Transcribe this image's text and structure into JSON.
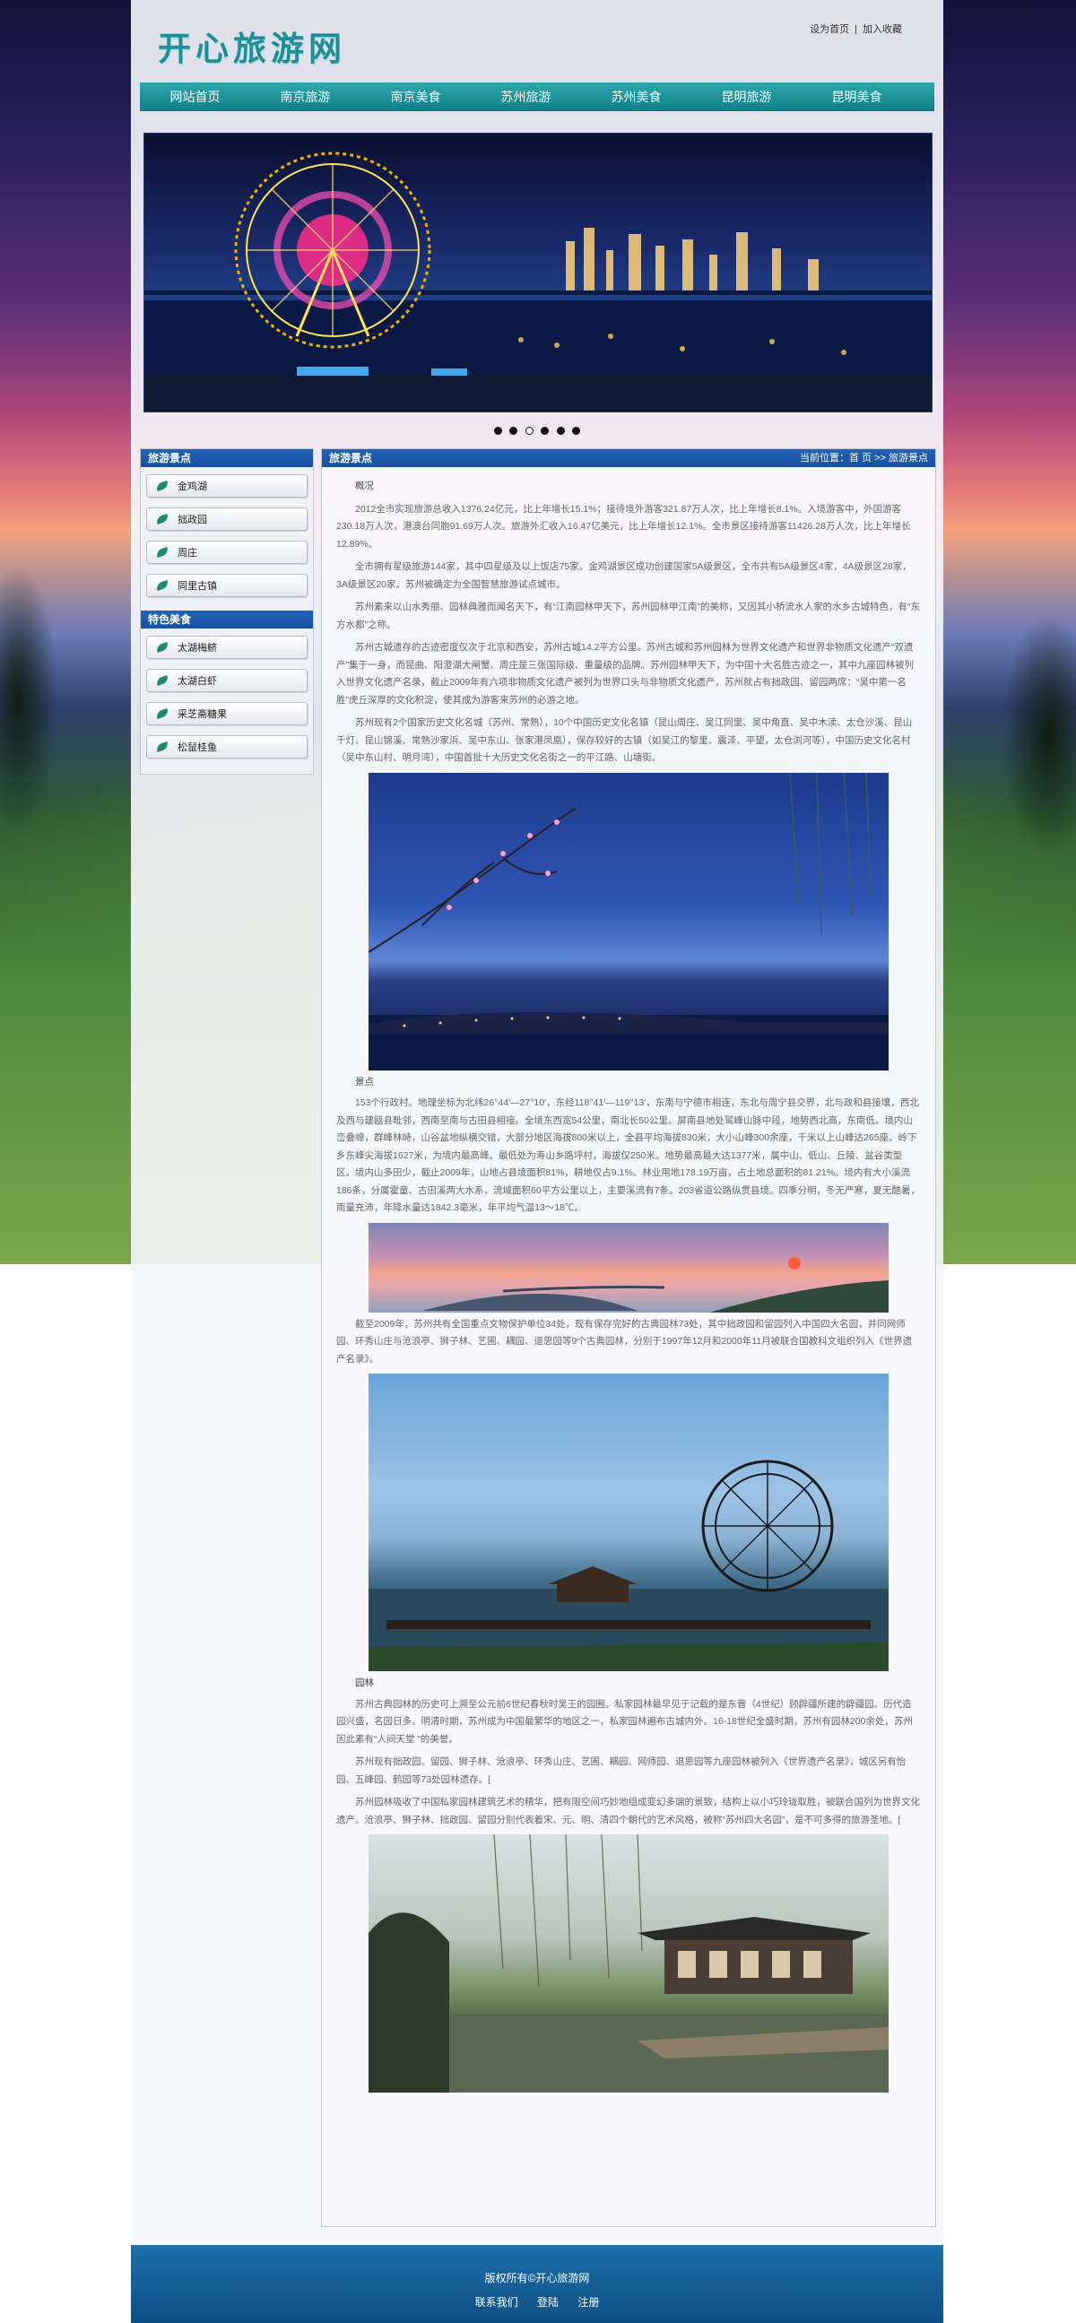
{
  "site": {
    "logo": "开心旅游网"
  },
  "toplinks": [
    "设为首页",
    "加入收藏"
  ],
  "nav": [
    "网站首页",
    "南京旅游",
    "南京美食",
    "苏州旅游",
    "苏州美食",
    "昆明旅游",
    "昆明美食"
  ],
  "carousel": {
    "count": 6,
    "active_index": 2
  },
  "sidebar": {
    "spots_title": "旅游景点",
    "spots": [
      "金鸡湖",
      "拙政园",
      "周庄",
      "同里古镇"
    ],
    "food_title": "特色美食",
    "food": [
      "太湖梅鲚",
      "太湖白虾",
      "采芝斋糖果",
      "松鼠桂鱼"
    ]
  },
  "main": {
    "title": "旅游景点",
    "breadcrumb": "当前位置：首 页 >> 旅游景点",
    "heading": "概况",
    "paras1": [
      "2012全市实现旅游总收入1376.24亿元，比上年增长15.1%；接待境外游客321.87万人次，比上年增长8.1%。入境游客中，外国游客230.18万人次，港澳台同胞91.69万人次。旅游外汇收入16.47亿美元，比上年增长12.1%。全市景区接待游客11426.28万人次，比上年增长12.89%。",
      "全市拥有星级旅游144家，其中四星级及以上饭店75家。金鸡湖景区成功创建国家5A级景区，全市共有5A级景区4家，4A级景区28家，3A级景区20家。苏州被确定为全国智慧旅游试点城市。",
      "苏州素来以山水秀丽、园林典雅而闻名天下，有“江南园林甲天下，苏州园林甲江南”的美称，又因其小桥流水人家的水乡古城特色，有“东方水都”之称。",
      "苏州古城遗存的古迹密度仅次于北京和西安，苏州古城14.2平方公里。苏州古城和苏州园林为世界文化遗产和世界非物质文化遗产“双遗产”集于一身，而昆曲、阳澄湖大闸蟹、周庄是三张国际级、重量级的品牌。苏州园林甲天下，为中国十大名胜古迹之一，其中九座园林被列入世界文化遗产名录，截止2009年有六项非物质文化遗产被列为世界口头与非物质文化遗产，苏州就占有拙政园、留园两席：“吴中第一名胜”虎丘深厚的文化积淀，使其成为游客来苏州的必游之地。",
      "苏州现有2个国家历史文化名城（苏州、常熟），10个中国历史文化名镇（昆山周庄、吴江同里、吴中角直、吴中木渎、太仓沙溪、昆山千灯、昆山锦溪、常熟沙家浜、吴中东山、张家港凤凰），保存较好的古镇（如吴江的黎里、震泽、平望，太仓浏河等），中国历史文化名村（吴中东山村、明月湾），中国首批十大历史文化名街之一的平江路、山塘街。"
    ],
    "cap1": "景点",
    "paras2": [
      "153个行政村。地理坐标为北纬26°44′—27°10′，东经118°41′—119°13′，东南与宁德市相连，东北与周宁县交界，北与政和县接壤，西北及西与建瓯县毗邻，西南至南与古田县相接。全境东西宽54公里，南北长50公里。屏南县地处鹫峰山脉中段，地势西北高，东南低。境内山峦叠嶂，群峰林峙，山谷盆地纵横交错，大部分地区海拔800米以上，全县平均海拔830米，大小山峰300余座，千米以上山峰达265座。岭下乡东峰尖海拔1627米，为境内最高峰。最低处为寿山乡路坪村，海拔仅250米。地势最高最大达1377米，属中山、低山、丘陵、盆谷类型区。境内山多田少，截止2009年，山地占县境面积81%，耕地仅占9.1%。林业用地178.19万亩，占土地总面积的81.21%。境内有大小溪流186条，分属霍童、古田溪两大水系，流域面积60平方公里以上，主要溪流有7条。203省道公路纵贯县境。四季分明，冬无严寒，夏无酷暑，雨量充沛，年降水量达1842.3毫米，年平均气温13～18℃。"
    ],
    "paras3": [
      "截至2009年，苏州共有全国重点文物保护单位34处，现有保存完好的古典园林73处，其中拙政园和留园列入中国四大名园，并同网师园、环秀山庄与沧浪亭、狮子林、艺圃、耦园、退思园等9个古典园林，分别于1997年12月和2000年11月被联合国教科文组织列入《世界遗产名录》。"
    ],
    "cap2": "园林",
    "paras4": [
      "苏州古典园林的历史可上溯至公元前6世纪春秋时吴王的园囿。私家园林最早见于记载的是东晋（4世纪）顾辟疆所建的辟疆园。历代造园兴盛，名园日多。明清时期，苏州成为中国最繁华的地区之一，私家园林遍布古城内外。16-18世纪全盛时期，苏州有园林200余处，苏州因此素有“人间天堂 ”的美誉。",
      "苏州现有拙政园、留园、狮子林、沧浪亭、环秀山庄、艺圃、耦园、网师园、退思园等九座园林被列入《世界遗产名录》，城区另有怡园、五峰园、鹤园等73处园林遗存。[",
      "苏州园林吸收了中国私家园林建筑艺术的精华，把有限空间巧妙地组成变幻多端的景致，结构上以小巧玲珑取胜，被联合国列为世界文化遗产。沧浪亭、狮子林、拙政园、留园分别代表着宋、元、明、清四个朝代的艺术风格，被称“苏州四大名园”，是不可多得的旅游圣地。["
    ]
  },
  "footer": {
    "copyright": "版权所有©开心旅游网",
    "links": [
      "联系我们",
      "登陆",
      "注册"
    ]
  }
}
